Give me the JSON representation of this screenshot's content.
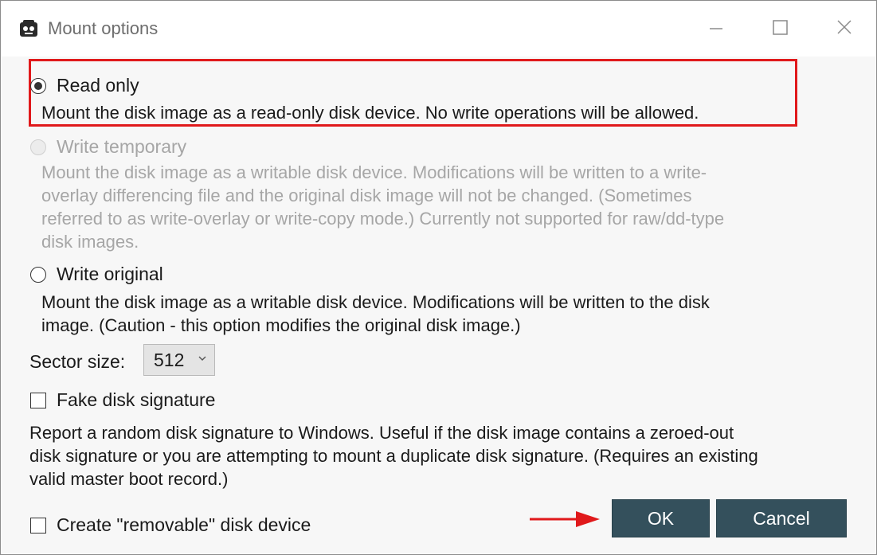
{
  "window": {
    "title": "Mount options"
  },
  "options": {
    "read_only": {
      "label": "Read only",
      "selected": true,
      "enabled": true,
      "description": "Mount the disk image as a read-only disk device. No write operations will be allowed."
    },
    "write_temporary": {
      "label": "Write temporary",
      "selected": false,
      "enabled": false,
      "description_lines": [
        "Mount the disk image as a writable disk device. Modifications will be written to a write-",
        "overlay differencing file and the original disk image will not be changed. (Sometimes",
        "referred to as write-overlay or write-copy mode.) Currently not supported for raw/dd-type",
        "disk images."
      ]
    },
    "write_original": {
      "label": "Write original",
      "selected": false,
      "enabled": true,
      "description_lines": [
        "Mount the disk image as a writable disk device. Modifications will be written to the disk",
        "image. (Caution - this option modifies the original disk image.)"
      ]
    }
  },
  "sector_size": {
    "label": "Sector size:",
    "value": "512"
  },
  "fake_disk_signature": {
    "label": "Fake disk signature",
    "checked": false,
    "description_lines": [
      "Report a random disk signature to Windows. Useful if the disk image contains a zeroed-out",
      "disk signature or you are attempting to mount a duplicate disk signature. (Requires an existing",
      "valid master boot record.)"
    ]
  },
  "removable": {
    "label": "Create \"removable\" disk device",
    "checked": false
  },
  "buttons": {
    "ok": "OK",
    "cancel": "Cancel"
  },
  "colors": {
    "highlight_box": "#e0191b",
    "arrow": "#e0191b",
    "button_bg": "#34505c",
    "disabled_text": "#a6a6a6"
  },
  "icons": {
    "app": "app-icon",
    "minimize": "minimize-icon",
    "maximize": "maximize-icon",
    "close": "close-icon",
    "chevron": "chevron-down-icon",
    "arrow": "arrow-right-icon"
  }
}
